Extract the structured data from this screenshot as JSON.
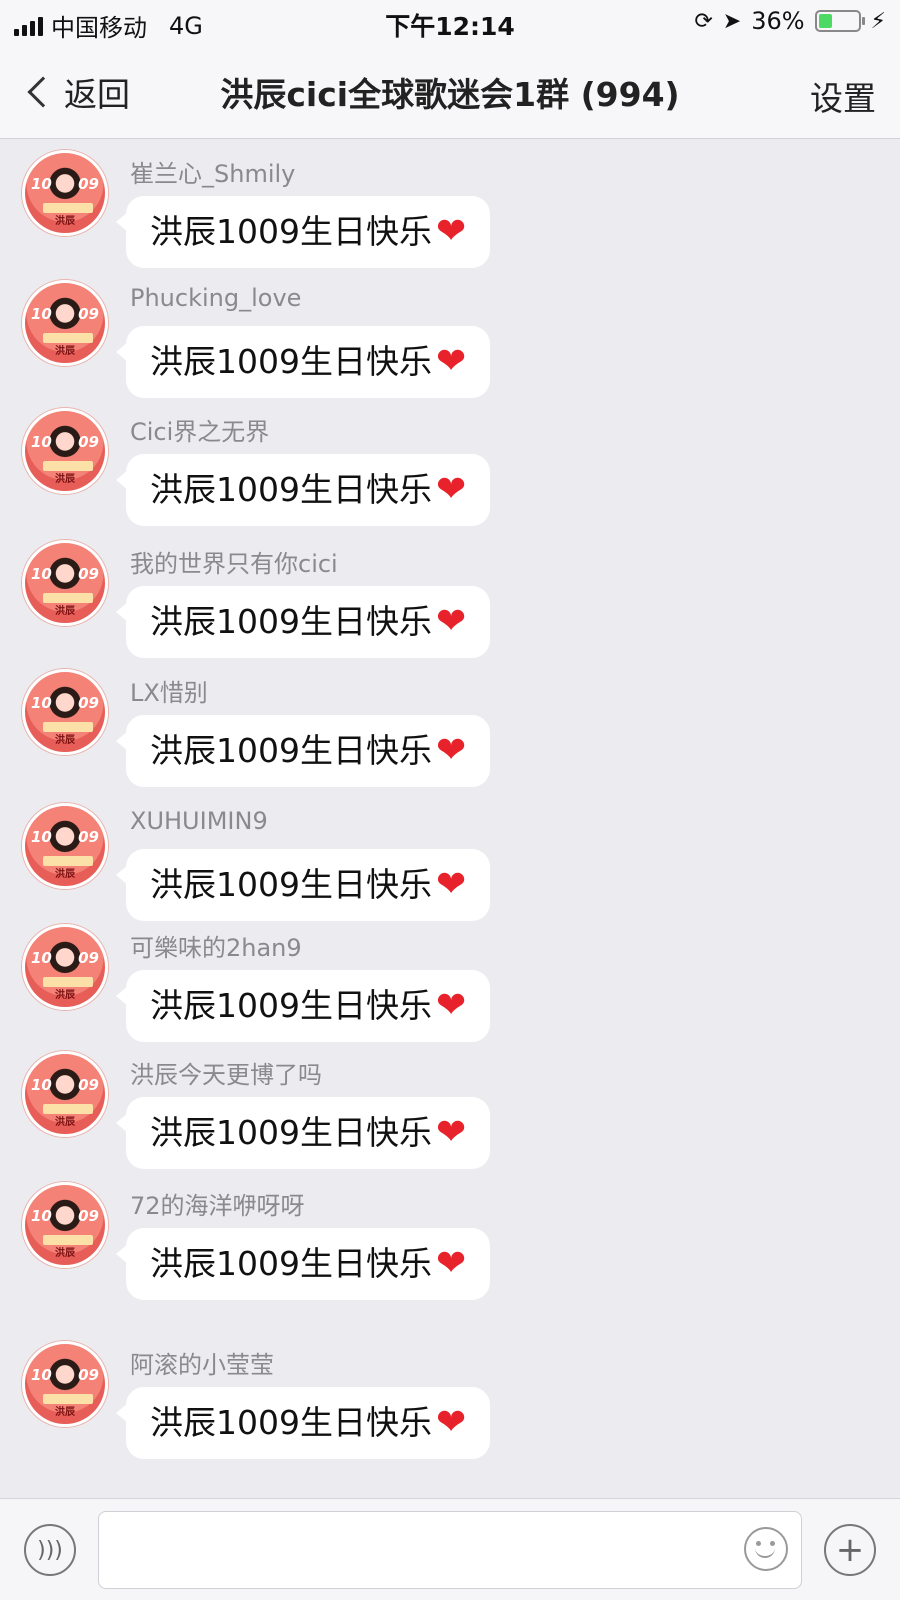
{
  "status_bar": {
    "carrier": "中国移动",
    "network": "4G",
    "time": "下午12:14",
    "battery_percent_label": "36%",
    "battery_level": 0.36
  },
  "nav": {
    "back_label": "返回",
    "title": "洪辰cici全球歌迷会1群 (994)",
    "settings_label": "设置"
  },
  "avatar": {
    "digits_left": "10",
    "digits_right": "09",
    "tag": "洪辰"
  },
  "messages": [
    {
      "sender": "崔兰心_Shmily",
      "text": "洪辰1009生日快乐",
      "emoji": "❤"
    },
    {
      "sender": "Phucking_love",
      "text": "洪辰1009生日快乐",
      "emoji": "❤"
    },
    {
      "sender": "Cici界之无界",
      "text": "洪辰1009生日快乐",
      "emoji": "❤"
    },
    {
      "sender": "我的世界只有你cici",
      "text": "洪辰1009生日快乐",
      "emoji": "❤"
    },
    {
      "sender": "LX惜别",
      "text": "洪辰1009生日快乐",
      "emoji": "❤"
    },
    {
      "sender": "XUHUIMIN9",
      "text": "洪辰1009生日快乐",
      "emoji": "❤"
    },
    {
      "sender": "可樂味的2han9",
      "text": "洪辰1009生日快乐",
      "emoji": "❤"
    },
    {
      "sender": "洪辰今天更博了吗",
      "text": "洪辰1009生日快乐",
      "emoji": "❤"
    },
    {
      "sender": "72的海洋咿呀呀",
      "text": "洪辰1009生日快乐",
      "emoji": "❤"
    },
    {
      "sender": "阿滚的小莹莹",
      "text": "洪辰1009生日快乐",
      "emoji": "❤"
    }
  ],
  "input_bar": {
    "placeholder": "",
    "voice_icon": "voice-icon",
    "emoji_icon": "emoji-icon",
    "plus_icon": "plus-icon",
    "plus_glyph": "+"
  }
}
